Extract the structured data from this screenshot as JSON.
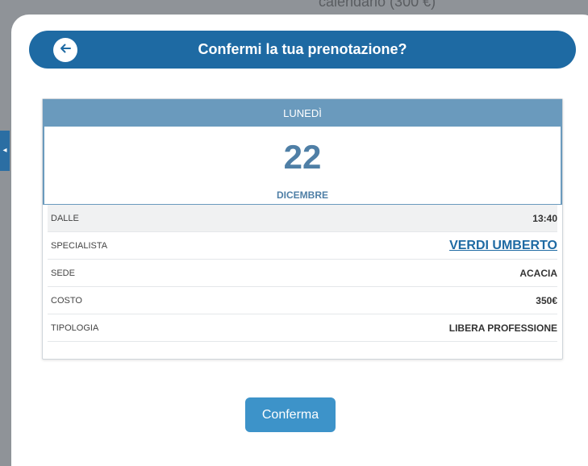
{
  "background": {
    "partial_text": "calendario (300 €)"
  },
  "header": {
    "title": "Confermi la tua prenotazione?",
    "back_icon": "arrow-left-icon"
  },
  "appointment": {
    "weekday": "LUNEDÌ",
    "day": "22",
    "month": "DICEMBRE",
    "rows": [
      {
        "label": "DALLE",
        "value": "13:40"
      },
      {
        "label": "SPECIALISTA",
        "value": "VERDI UMBERTO"
      },
      {
        "label": "SEDE",
        "value": "ACACIA"
      },
      {
        "label": "COSTO",
        "value": "350€"
      },
      {
        "label": "TIPOLOGIA",
        "value": "LIBERA PROFESSIONE"
      }
    ]
  },
  "actions": {
    "confirm_label": "Conferma"
  },
  "colors": {
    "primary": "#1e6aa3",
    "accent": "#6a9abd",
    "button": "#3d93c9"
  }
}
